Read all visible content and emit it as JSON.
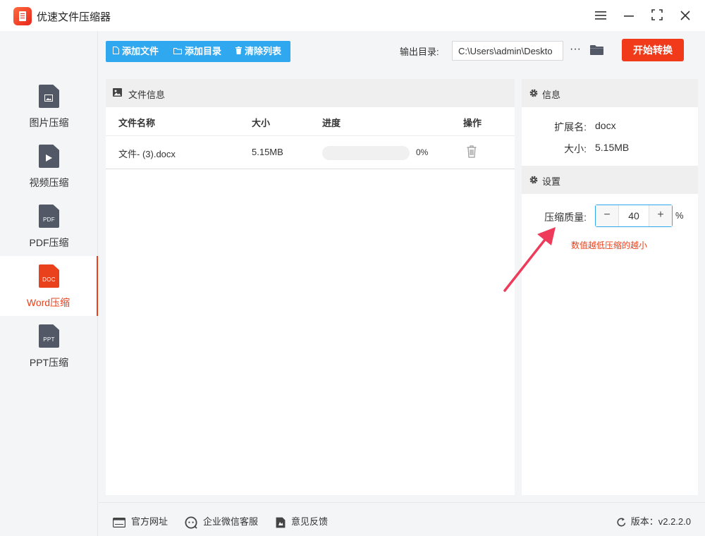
{
  "app": {
    "title": "优速文件压缩器"
  },
  "window_controls": [
    "menu-icon",
    "minimize-icon",
    "maximize-icon",
    "close-icon"
  ],
  "sidebar": {
    "items": [
      {
        "label": "图片压缩",
        "icon": "image-file-icon",
        "tag": "",
        "active": false
      },
      {
        "label": "视频压缩",
        "icon": "video-file-icon",
        "tag": "",
        "active": false
      },
      {
        "label": "PDF压缩",
        "icon": "pdf-file-icon",
        "tag": "PDF",
        "active": false
      },
      {
        "label": "Word压缩",
        "icon": "doc-file-icon",
        "tag": "DOC",
        "active": true
      },
      {
        "label": "PPT压缩",
        "icon": "ppt-file-icon",
        "tag": "PPT",
        "active": false
      }
    ]
  },
  "toolbar": {
    "add_file": "添加文件",
    "add_folder": "添加目录",
    "clear_list": "清除列表",
    "output_label": "输出目录:",
    "output_path": "C:\\Users\\admin\\Deskto",
    "more": "···",
    "start": "开始转换"
  },
  "file_panel": {
    "title": "文件信息",
    "columns": {
      "name": "文件名称",
      "size": "大小",
      "progress": "进度",
      "action": "操作"
    },
    "rows": [
      {
        "name": "文件- (3).docx",
        "size": "5.15MB",
        "progress": 0,
        "progress_text": "0%"
      }
    ]
  },
  "info_panel": {
    "title": "信息",
    "ext_label": "扩展名:",
    "ext_value": "docx",
    "size_label": "大小:",
    "size_value": "5.15MB"
  },
  "settings": {
    "title": "设置",
    "quality_label": "压缩质量:",
    "minus": "−",
    "plus": "+",
    "quality_value": "40",
    "unit": "%",
    "hint": "数值越低压缩的越小"
  },
  "colors": {
    "accent": "#2fa8f0",
    "primary": "#f03a1a",
    "active": "#e8411c"
  },
  "footer": {
    "website": "官方网址",
    "wechat": "企业微信客服",
    "feedback": "意见反馈",
    "version": "版本：v2.2.2.0"
  }
}
